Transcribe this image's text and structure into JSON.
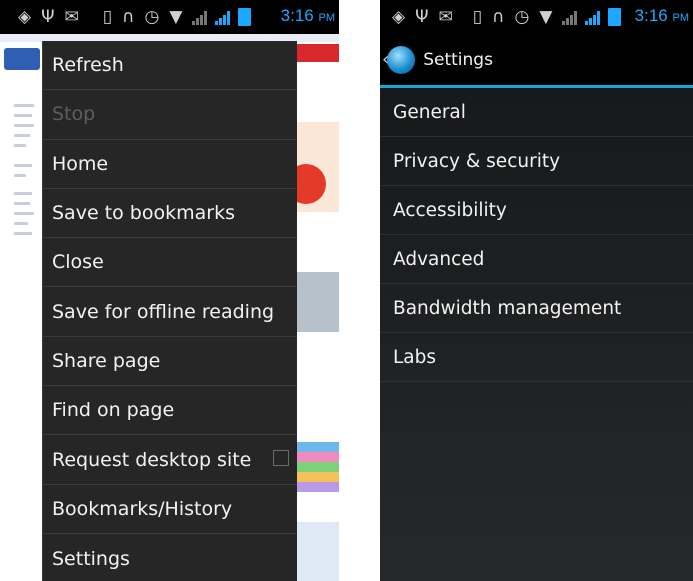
{
  "left": {
    "status": {
      "time": "3:16",
      "ampm": "PM"
    },
    "menu_items": [
      {
        "label": "Refresh",
        "enabled": true
      },
      {
        "label": "Stop",
        "enabled": false
      },
      {
        "label": "Home",
        "enabled": true
      },
      {
        "label": "Save to bookmarks",
        "enabled": true
      },
      {
        "label": "Close",
        "enabled": true
      },
      {
        "label": "Save for offline reading",
        "enabled": true
      },
      {
        "label": "Share page",
        "enabled": true
      },
      {
        "label": "Find on page",
        "enabled": true
      },
      {
        "label": "Request desktop site",
        "enabled": true,
        "checkbox": true,
        "checked": false
      },
      {
        "label": "Bookmarks/History",
        "enabled": true
      },
      {
        "label": "Settings",
        "enabled": true
      }
    ]
  },
  "right": {
    "status": {
      "time": "3:16",
      "ampm": "PM"
    },
    "title": "Settings",
    "items": [
      "General",
      "Privacy & security",
      "Accessibility",
      "Advanced",
      "Bandwidth management",
      "Labs"
    ]
  },
  "icons": {
    "status_left": [
      "location-icon",
      "usb-icon",
      "mail-icon",
      "vibrate-icon",
      "headset-icon",
      "alarm-icon",
      "wifi-icon"
    ],
    "back": "chevron-left-icon",
    "browser": "globe-icon"
  },
  "colors": {
    "accent": "#1aa3d6",
    "time": "#1ea7ff",
    "menu_bg": "#262626"
  }
}
